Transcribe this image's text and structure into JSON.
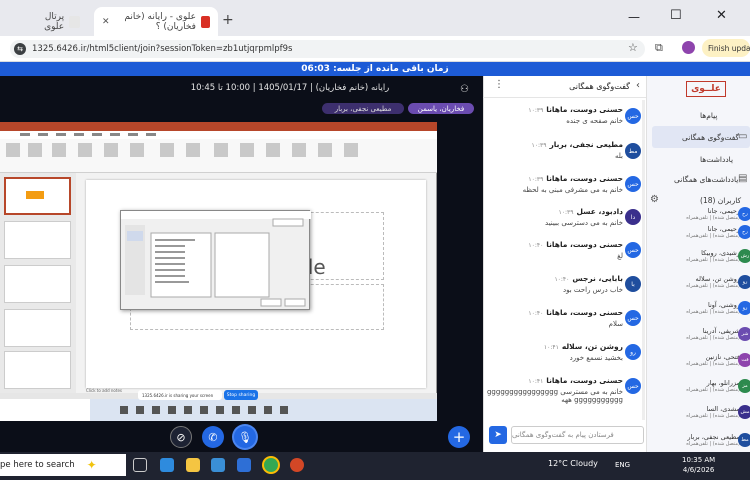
{
  "browser": {
    "tabs": [
      {
        "title": "پرتال علوی",
        "favicon_color": "#e6e6e6"
      },
      {
        "title": "علوی - رایانه (خانم فخاریان) ؟",
        "favicon_color": "#d93025",
        "active": true
      }
    ],
    "new_tab": "+",
    "url": "1325.6426.ir/html5client/join?sessionToken=zb1utjqrpmlpf9s",
    "finish_update": "Finish update",
    "window_controls": {
      "minimize": "—",
      "maximize": "☐",
      "close": "✕"
    }
  },
  "session": {
    "timer_label": "زمان باقی مانده از جلسه: 06:03"
  },
  "meeting": {
    "title": "رایانه (خانم فخاریان) | 1405/01/17 | 10:00 تا 10:45",
    "active_speaker": "فخاریان، یاسمن",
    "other_speaker": "مطیعی نجفی، بربار",
    "slide_placeholder": "tle",
    "share_notice": "1325.6426.ir is sharing your screen",
    "stop_sharing": "Stop sharing",
    "notes_placeholder": "Click to add notes",
    "controls": {
      "camera": "camera-off",
      "phone": "phone",
      "mic": "mic",
      "plus": "+"
    }
  },
  "chat": {
    "title": "گفت‌وگوی همگانی",
    "input_placeholder": "فرستادن پیام به گفت‌وگوی همگانی",
    "messages": [
      {
        "name": "حسنی دوست، ماهانا",
        "time": "۱۰:۳۹",
        "text": "خانم صفحه ی جنده",
        "avatar": "حس",
        "color": "#2468e3"
      },
      {
        "name": "مطیعی نجفی، بربار",
        "time": "۱۰:۳۹",
        "text": "بله",
        "avatar": "مط",
        "color": "#1f4e9e"
      },
      {
        "name": "حسنی دوست، ماهانا",
        "time": "۱۰:۳۹",
        "text": "خانم به می مشرفی مبنی به لحظه",
        "avatar": "حس",
        "color": "#2468e3"
      },
      {
        "name": "دادبود، عسل",
        "time": "۱۰:۳۹",
        "text": "خانم به می دسترسی ببینید",
        "avatar": "دا",
        "color": "#3a2f8c"
      },
      {
        "name": "حسنی دوست، ماهانا",
        "time": "۱۰:۴۰",
        "text": "لغ",
        "avatar": "حس",
        "color": "#2468e3"
      },
      {
        "name": "بابایی، نرجس",
        "time": "۱۰:۴۰",
        "text": "خاب درس راحت بود",
        "avatar": "با",
        "color": "#1f4e9e"
      },
      {
        "name": "حسنی دوست، ماهانا",
        "time": "۱۰:۴۰",
        "text": "سلام",
        "avatar": "حس",
        "color": "#2468e3"
      },
      {
        "name": "روشن تن، سلاله",
        "time": "۱۰:۴۱",
        "text": "بخشید نسمع خورد",
        "avatar": "رو",
        "color": "#2468e3"
      },
      {
        "name": "حسنی دوست، ماهانا",
        "time": "۱۰:۴۱",
        "text": "خانم به می مسترسی ggggggggggggggggggggggggggg ههه",
        "avatar": "حس",
        "color": "#2468e3"
      }
    ]
  },
  "sidebar": {
    "logo": "علــوی",
    "section_messages": "پیام‌ها",
    "public_chat": "گفت‌وگوی همگانی",
    "section_notes": "یادداشت‌ها",
    "shared_notes": "یادداشت‌های همگانی",
    "users_header": "کاربران (18)",
    "users": [
      {
        "name": "رحیمی، جانا",
        "status": "(متصل شده) | تلفن‌همراه",
        "avatar": "رح",
        "color": "#2468e3"
      },
      {
        "name": "رشیدی، روبیکا",
        "status": "(متصل شده) | تلفن‌همراه",
        "avatar": "رش",
        "color": "#2d8a4e"
      },
      {
        "name": "روشن تن، سلاله",
        "status": "(متصل شده) | تلفن‌همراه",
        "avatar": "رو",
        "color": "#1f4e9e"
      },
      {
        "name": "روشنی، آونا",
        "status": "(متصل شده) | تلفن‌همراه",
        "avatar": "رو",
        "color": "#2468e3"
      },
      {
        "name": "شریفی، آدرینا",
        "status": "(متصل شده) | تلفن‌همراه",
        "avatar": "شر",
        "color": "#6b4cb0"
      },
      {
        "name": "فتحی، نازنین",
        "status": "(متصل شده) | تلفن‌همراه",
        "avatar": "فت",
        "color": "#8e44ad"
      },
      {
        "name": "مزرانلو، بهار",
        "status": "(متصل شده) | تلفن‌همراه",
        "avatar": "مز",
        "color": "#2d8a4e"
      },
      {
        "name": "مشدی، السا",
        "status": "(متصل شده) | تلفن‌همراه",
        "avatar": "مش",
        "color": "#3a2f8c"
      },
      {
        "name": "مطیعی نجفی، بربار",
        "status": "(متصل شده) | تلفن‌همراه",
        "avatar": "مط",
        "color": "#1f4e9e"
      }
    ]
  },
  "taskbar": {
    "search_placeholder": "pe here to search",
    "weather": "12°C Cloudy",
    "lang": "ENG",
    "time": "10:35 AM",
    "date": "4/6/2026"
  }
}
